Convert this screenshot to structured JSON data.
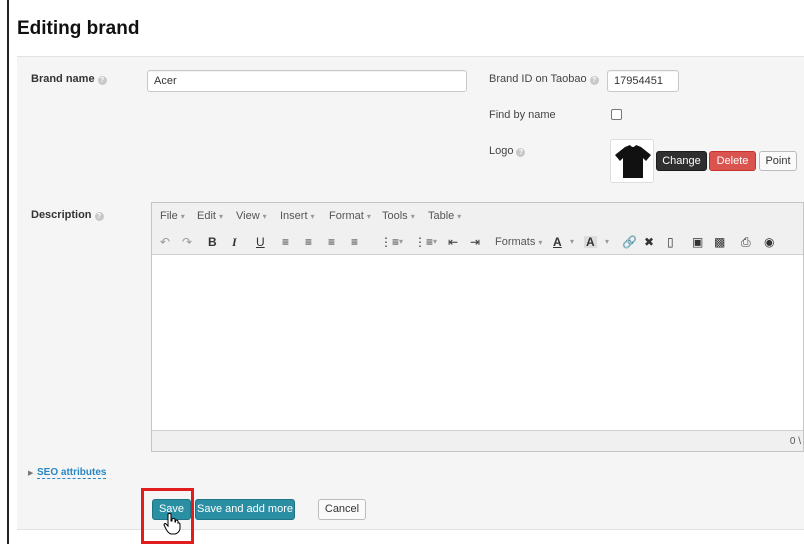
{
  "page": {
    "title": "Editing brand"
  },
  "form": {
    "brand_name_label": "Brand name",
    "brand_name_value": "Acer",
    "taobao_id_label": "Brand ID on Taobao",
    "taobao_id_value": "17954451",
    "find_by_name_label": "Find by name",
    "find_by_name_checked": false,
    "logo_label": "Logo",
    "logo_buttons": {
      "change": "Change",
      "delete": "Delete",
      "point": "Point"
    },
    "description_label": "Description"
  },
  "editor": {
    "menu": [
      "File",
      "Edit",
      "View",
      "Insert",
      "Format",
      "Tools",
      "Table"
    ],
    "toolbar": {
      "undo_icon": "undo-icon",
      "redo_icon": "redo-icon",
      "bold": "B",
      "italic": "I",
      "underline": "U",
      "formats_label": "Formats",
      "text_color": "A",
      "background_color": "A"
    },
    "status_text": "0 \\"
  },
  "seo": {
    "label": "SEO attributes"
  },
  "actions": {
    "save": "Save",
    "save_add_more": "Save and add more",
    "cancel": "Cancel"
  },
  "colors": {
    "accent_teal": "#2a8fa3",
    "delete_red": "#d9534f",
    "highlight_red": "#e01c1c",
    "link_blue": "#2a87c2"
  }
}
